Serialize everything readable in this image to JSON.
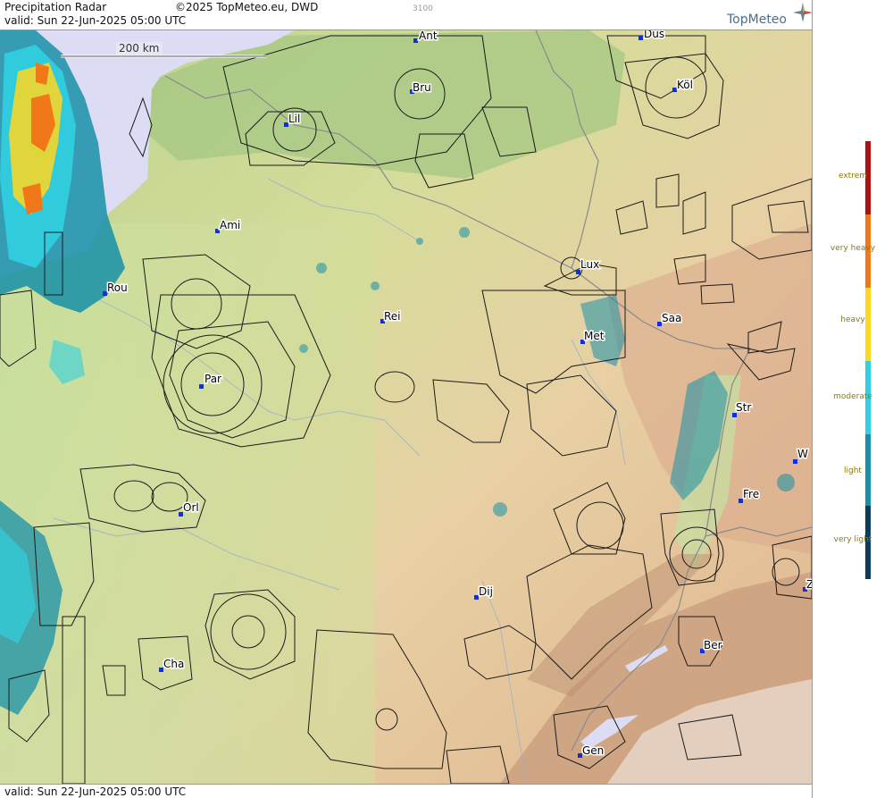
{
  "header": {
    "title": "Precipitation Radar",
    "copyright": "©2025 TopMeteo.eu, DWD",
    "valid": "valid:  Sun  22-Jun-2025 05:00 UTC",
    "code": "3100",
    "brand": "TopMeteo"
  },
  "footer": {
    "valid": "valid:  Sun  22-Jun-2025 05:00 UTC"
  },
  "scale": {
    "label": "200 km"
  },
  "legend": {
    "items": [
      {
        "label": "extrem",
        "color": "#b01010"
      },
      {
        "label": "very heavy",
        "color": "#f07818"
      },
      {
        "label": "heavy",
        "color": "#ffd820"
      },
      {
        "label": "moderate",
        "color": "#30d0e0"
      },
      {
        "label": "light",
        "color": "#1890a8"
      },
      {
        "label": "very light",
        "color": "#0c3c5c"
      }
    ]
  },
  "cities": [
    {
      "name": "Ant"
    },
    {
      "name": "Düs"
    },
    {
      "name": "Bru"
    },
    {
      "name": "Köl"
    },
    {
      "name": "Lil"
    },
    {
      "name": "Ami"
    },
    {
      "name": "Rou"
    },
    {
      "name": "Lux"
    },
    {
      "name": "Rei"
    },
    {
      "name": "Saa"
    },
    {
      "name": "Met"
    },
    {
      "name": "Par"
    },
    {
      "name": "Str"
    },
    {
      "name": "W"
    },
    {
      "name": "Fre"
    },
    {
      "name": "Orl"
    },
    {
      "name": "Dij"
    },
    {
      "name": "Z"
    },
    {
      "name": "Ber"
    },
    {
      "name": "Cha"
    },
    {
      "name": "Gen"
    }
  ]
}
